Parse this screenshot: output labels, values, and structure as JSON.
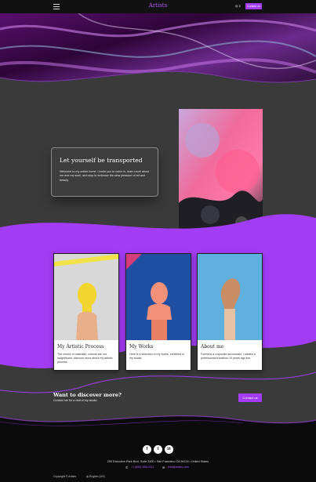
{
  "header": {
    "logo": "Artists",
    "lang_short": "E",
    "contact_label": "Contact us"
  },
  "intro": {
    "title": "Let yourself be transported",
    "text": "Welcome to my online home. I invite you to come in, learn more about me and my work, and stop to embrace the slow pleasure of art and beauty."
  },
  "cards": [
    {
      "title": "My Artistic Process",
      "text": "The choice of materials, colours are not insignificant, discover more about my artistic process."
    },
    {
      "title": "My Works",
      "text": "Here is a selection of my works, exhibited in my studio."
    },
    {
      "title": "About me",
      "text": "Formerly a corporate accountant, I started a professional transition 10 years ago live."
    }
  ],
  "discover": {
    "title": "Want to discover more?",
    "subtitle": "Contact me for a visit of my studio.",
    "button": "Contact us"
  },
  "footer": {
    "social": [
      "f",
      "t",
      "in"
    ],
    "address": "250 Executive Park Blvd, Suite 3400 • San Francisco CA 94134 • United States",
    "phone": "+1 (650) 555-0111",
    "email": "info@artists.com",
    "copyright": "Copyright © Artists",
    "language": "English (US)"
  },
  "colors": {
    "accent": "#a23cf5",
    "background": "#3a3a3a",
    "header": "#111111"
  },
  "icons": [
    "menu-icon",
    "phone-icon",
    "email-icon",
    "globe-icon",
    "facebook-icon",
    "twitter-icon",
    "linkedin-icon"
  ]
}
